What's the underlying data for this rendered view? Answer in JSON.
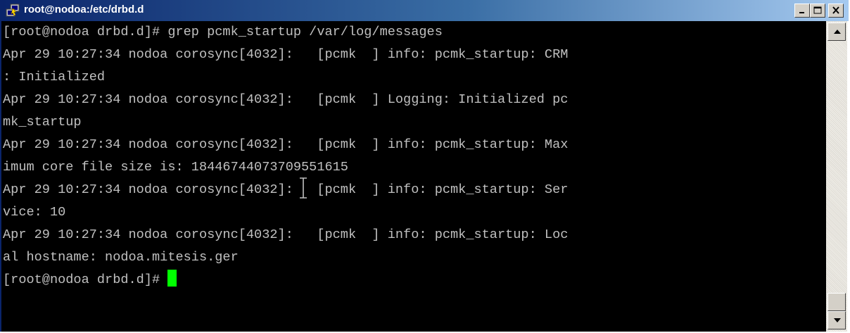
{
  "window": {
    "title": "root@nodoa:/etc/drbd.d",
    "icon": "putty-icon",
    "controls": [
      "minimize-icon",
      "maximize-icon",
      "close-icon"
    ]
  },
  "terminal": {
    "lines": [
      "[root@nodoa drbd.d]# grep pcmk_startup /var/log/messages",
      "Apr 29 10:27:34 nodoa corosync[4032]:   [pcmk  ] info: pcmk_startup: CRM",
      ": Initialized",
      "Apr 29 10:27:34 nodoa corosync[4032]:   [pcmk  ] Logging: Initialized pc",
      "mk_startup",
      "Apr 29 10:27:34 nodoa corosync[4032]:   [pcmk  ] info: pcmk_startup: Max",
      "imum core file size is: 18446744073709551615",
      "Apr 29 10:27:34 nodoa corosync[4032]:   [pcmk  ] info: pcmk_startup: Ser",
      "vice: 10",
      "Apr 29 10:27:34 nodoa corosync[4032]:   [pcmk  ] info: pcmk_startup: Loc",
      "al hostname: nodoa.mitesis.ger"
    ],
    "prompt": "[root@nodoa drbd.d]# ",
    "text_color": "#c0c0c0",
    "background_color": "#000000",
    "cursor_color": "#00ff00"
  },
  "scrollbar": {
    "up_icon": "scroll-up-arrow-icon",
    "down_icon": "scroll-down-arrow-icon"
  }
}
